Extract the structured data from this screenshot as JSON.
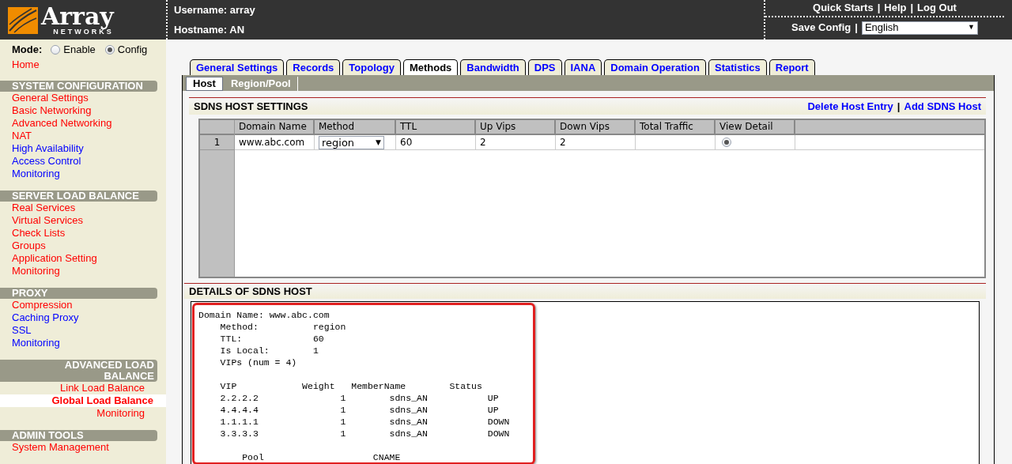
{
  "logo": {
    "name": "Array",
    "tagline": "NETWORKS"
  },
  "header": {
    "username": "Username: array",
    "hostname": "Hostname: AN",
    "links": [
      "Quick Starts",
      "Help",
      "Log Out"
    ],
    "save_config": "Save Config",
    "separator": "|",
    "language": {
      "value": "English",
      "caret": "▼"
    }
  },
  "mode": {
    "label": "Mode:",
    "options": [
      {
        "label": "Enable",
        "selected": false
      },
      {
        "label": "Config",
        "selected": true
      }
    ]
  },
  "home": {
    "label": "Home",
    "color": "#ff0000"
  },
  "sidebar": [
    {
      "title": "SYSTEM CONFIGURATION",
      "kind": "left",
      "items": [
        {
          "label": "General Settings",
          "color": "#ff0000",
          "selected": false
        },
        {
          "label": "Basic Networking",
          "color": "#ff0000",
          "selected": false
        },
        {
          "label": "Advanced Networking",
          "color": "#ff0000",
          "selected": false
        },
        {
          "label": "NAT",
          "color": "#ff0000",
          "selected": false
        },
        {
          "label": "High Availability",
          "color": "#0000ff",
          "selected": false
        },
        {
          "label": "Access Control",
          "color": "#0000ff",
          "selected": false
        },
        {
          "label": "Monitoring",
          "color": "#0000ff",
          "selected": false
        }
      ]
    },
    {
      "title": "SERVER LOAD BALANCE",
      "kind": "left",
      "items": [
        {
          "label": "Real Services",
          "color": "#ff0000",
          "selected": false
        },
        {
          "label": "Virtual Services",
          "color": "#ff0000",
          "selected": false
        },
        {
          "label": "Check Lists",
          "color": "#ff0000",
          "selected": false
        },
        {
          "label": "Groups",
          "color": "#ff0000",
          "selected": false
        },
        {
          "label": "Application Setting",
          "color": "#ff0000",
          "selected": false
        },
        {
          "label": "Monitoring",
          "color": "#ff0000",
          "selected": false
        }
      ]
    },
    {
      "title": "PROXY",
      "kind": "left",
      "items": [
        {
          "label": "Compression",
          "color": "#ff0000",
          "selected": false
        },
        {
          "label": "Caching Proxy",
          "color": "#0000ff",
          "selected": false
        },
        {
          "label": "SSL",
          "color": "#0000ff",
          "selected": false
        },
        {
          "label": "Monitoring",
          "color": "#0000ff",
          "selected": false
        }
      ]
    },
    {
      "title": "ADVANCED LOAD BALANCE",
      "kind": "right",
      "items": [
        {
          "label": "Link Load Balance",
          "color": "#ff0000",
          "selected": false
        },
        {
          "label": "Global Load Balance",
          "color": "#ff0000",
          "selected": true
        },
        {
          "label": "Monitoring",
          "color": "#ff0000",
          "selected": false
        }
      ]
    },
    {
      "title": "ADMIN TOOLS",
      "kind": "left",
      "items": [
        {
          "label": "System Management",
          "color": "#ff0000",
          "selected": false
        }
      ]
    }
  ],
  "tabs": [
    {
      "label": "General Settings",
      "selected": false
    },
    {
      "label": "Records",
      "selected": false
    },
    {
      "label": "Topology",
      "selected": false
    },
    {
      "label": "Methods",
      "selected": true
    },
    {
      "label": "Bandwidth",
      "selected": false
    },
    {
      "label": "DPS",
      "selected": false
    },
    {
      "label": "IANA",
      "selected": false
    },
    {
      "label": "Domain Operation",
      "selected": false
    },
    {
      "label": "Statistics",
      "selected": false
    },
    {
      "label": "Report",
      "selected": false
    }
  ],
  "subtabs": [
    {
      "label": "Host",
      "selected": true
    },
    {
      "label": "Region/Pool",
      "selected": false
    }
  ],
  "host_settings": {
    "title": "SDNS HOST SETTINGS",
    "actions": [
      "Delete Host Entry",
      "Add SDNS Host"
    ],
    "separator": "|",
    "table": {
      "columns": [
        "Domain Name",
        "Method",
        "TTL",
        "Up Vips",
        "Down Vips",
        "Total Traffic",
        "View Detail"
      ],
      "rows": [
        {
          "number": "1",
          "domain_name": "www.abc.com",
          "method": "region",
          "method_caret": "▼",
          "ttl": "60",
          "up_vips": "2",
          "down_vips": "2",
          "selected": true
        }
      ]
    }
  },
  "details": {
    "title": "DETAILS OF SDNS HOST",
    "blocks": [
      [
        "Domain Name: www.abc.com",
        "    Method:          region",
        "    TTL:             60",
        "    Is Local:        1",
        "    VIPs (num = 4)"
      ],
      [
        "    VIP            Weight   MemberName        Status",
        "    2.2.2.2               1        sdns_AN           UP",
        "    4.4.4.4               1        sdns_AN           UP",
        "    1.1.1.1               1        sdns_AN           DOWN",
        "    3.3.3.3               1        sdns_AN           DOWN"
      ],
      [
        "        Pool                    CNAME"
      ]
    ],
    "highlighted": true
  }
}
